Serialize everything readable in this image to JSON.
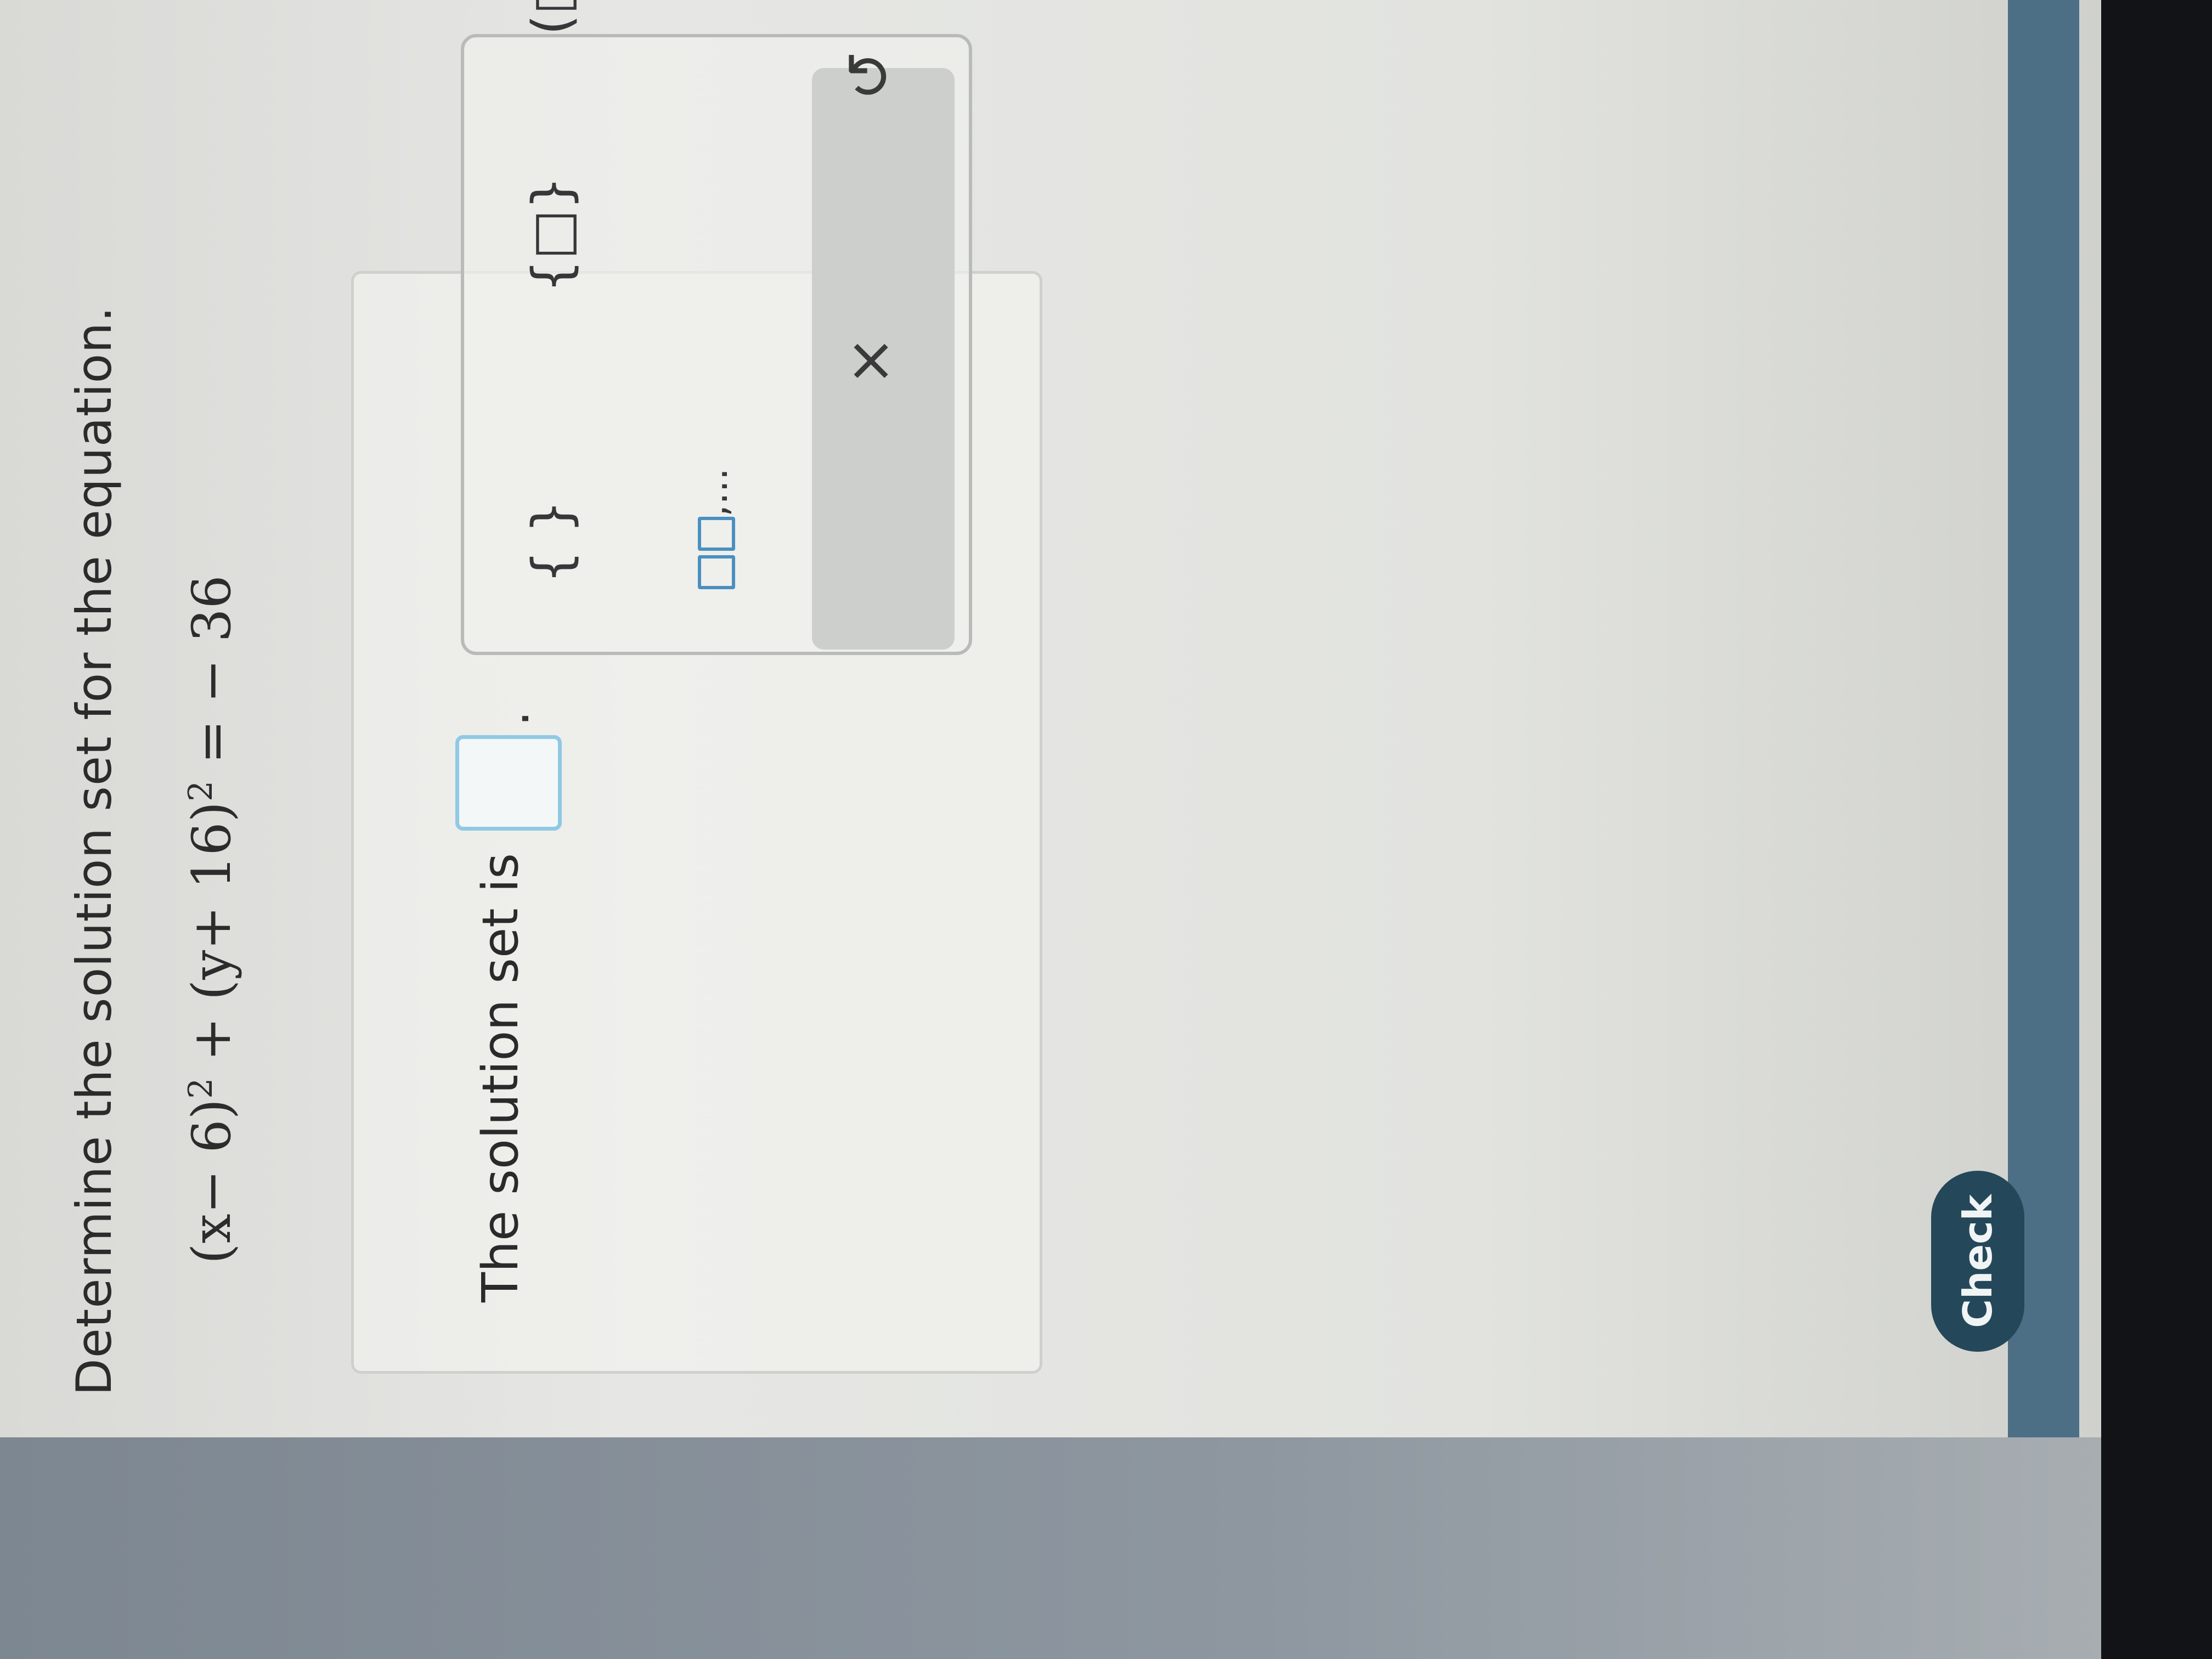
{
  "question": {
    "title": "Determine the solution set for the equation.",
    "equation": {
      "term1": "(x− 6)",
      "exp1": "2",
      "plus": " + ",
      "term2": "(y+ 16)",
      "exp2": "2",
      "rhs": " = − 36"
    }
  },
  "answer": {
    "prompt": "The solution set is",
    "period": ".",
    "input_value": ""
  },
  "palette": {
    "empty_set": "{ }",
    "set_braces": "{□}",
    "ordered_pair": "(□,□)",
    "list_suffix": ",...",
    "clear": "×",
    "undo": "↺"
  },
  "actions": {
    "check": "Check"
  },
  "colors": {
    "check_button": "#24485a",
    "input_border": "#8fc9e4",
    "list_box_border": "#4a90c0"
  }
}
